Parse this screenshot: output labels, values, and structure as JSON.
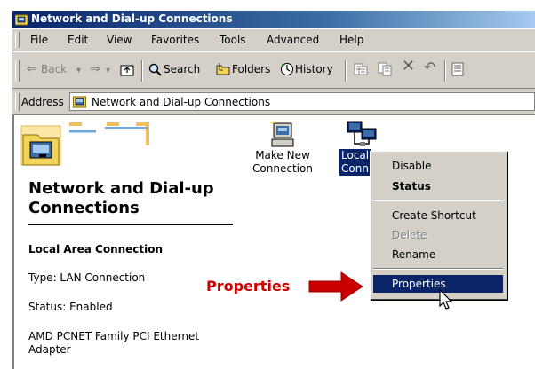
{
  "window": {
    "title": "Network and Dial-up Connections",
    "icon": "network-folder-icon"
  },
  "menubar": {
    "items": [
      "File",
      "Edit",
      "View",
      "Favorites",
      "Tools",
      "Advanced",
      "Help"
    ]
  },
  "toolbar": {
    "back": "Back",
    "search": "Search",
    "folders": "Folders",
    "history": "History"
  },
  "address": {
    "label": "Address",
    "value": "Network and Dial-up Connections"
  },
  "left_panel": {
    "title": "Network and Dial-up Connections",
    "connection_name": "Local Area Connection",
    "type": "Type: LAN Connection",
    "status": "Status: Enabled",
    "adapter": "AMD PCNET Family PCI Ethernet Adapter"
  },
  "icons": [
    {
      "label": "Make New\nConnection",
      "icon": "make-new-connection-icon"
    },
    {
      "label": "Local\nConn",
      "icon": "lan-connection-icon",
      "selected": true
    }
  ],
  "context_menu": {
    "items": [
      {
        "label": "Disable"
      },
      {
        "label": "Status",
        "bold": true
      },
      {
        "label": "Create Shortcut"
      },
      {
        "label": "Delete",
        "disabled": true
      },
      {
        "label": "Rename"
      },
      {
        "label": "Properties",
        "selected": true
      }
    ]
  },
  "annotation": {
    "label": "Properties",
    "color": "#cc0000"
  },
  "colors": {
    "chrome": "#d4d0c8",
    "selection": "#0a246a",
    "title_start": "#0a246a"
  }
}
